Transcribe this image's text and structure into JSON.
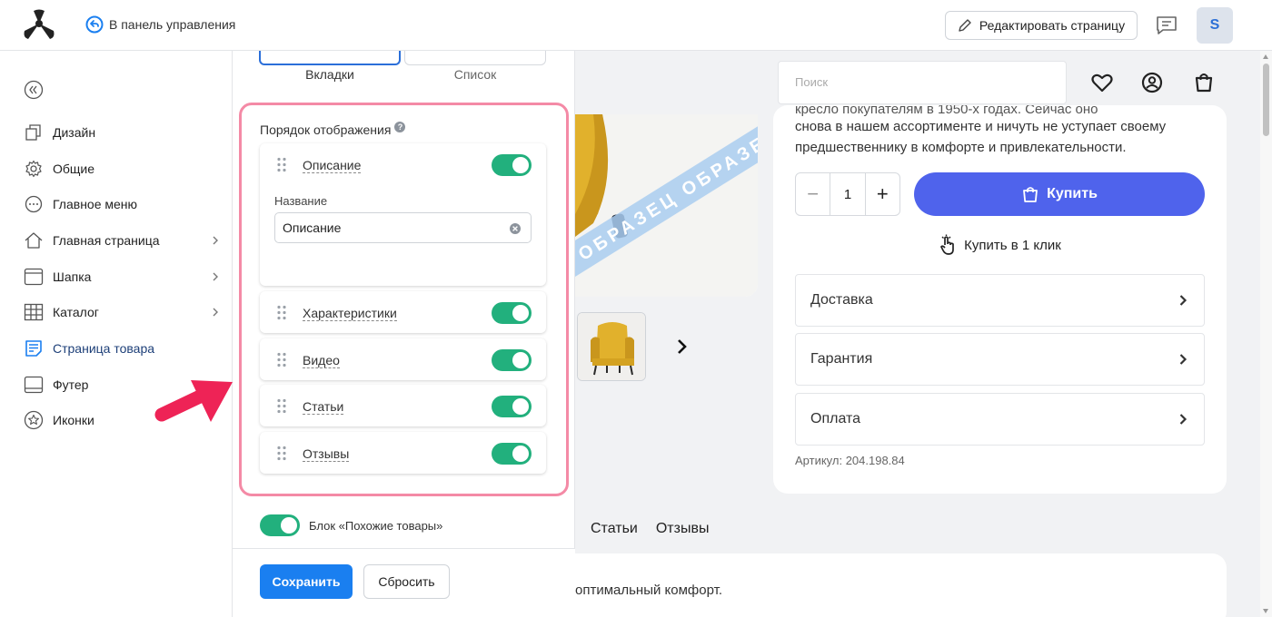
{
  "header": {
    "back_label": "В панель управления",
    "edit_page_label": "Редактировать страницу",
    "avatar_letter": "S"
  },
  "sidebar": {
    "items": [
      {
        "label": "Дизайн",
        "icon": "copy-icon"
      },
      {
        "label": "Общие",
        "icon": "gear-icon"
      },
      {
        "label": "Главное меню",
        "icon": "more-circle-icon"
      },
      {
        "label": "Главная страница",
        "icon": "home-icon",
        "has_submenu": true
      },
      {
        "label": "Шапка",
        "icon": "header-layout-icon",
        "has_submenu": true
      },
      {
        "label": "Каталог",
        "icon": "grid-icon",
        "has_submenu": true
      },
      {
        "label": "Страница товара",
        "icon": "document-icon",
        "active": true
      },
      {
        "label": "Футер",
        "icon": "footer-layout-icon"
      },
      {
        "label": "Иконки",
        "icon": "star-circle-icon"
      }
    ]
  },
  "panel": {
    "view_options": [
      "Вкладки",
      "Список"
    ],
    "selected_view": "Вкладки",
    "order_title": "Порядок отображения",
    "sections": [
      {
        "label": "Описание",
        "enabled": true,
        "expanded": true,
        "name_field_label": "Название",
        "name_field_value": "Описание"
      },
      {
        "label": "Характеристики",
        "enabled": true
      },
      {
        "label": "Видео",
        "enabled": true
      },
      {
        "label": "Статьи",
        "enabled": true
      },
      {
        "label": "Отзывы",
        "enabled": true
      }
    ],
    "similar_products_label": "Блок «Похожие товары»",
    "similar_products_enabled": true,
    "save_label": "Сохранить",
    "reset_label": "Сбросить"
  },
  "preview": {
    "search_placeholder": "Поиск",
    "watermark": "ОБРАЗЕЦ ОБРАЗЕЦ",
    "description_lines": [
      "кресло покупателям в 1950-х годах. Сейчас оно",
      "снова в нашем ассортименте и ничуть не уступает своему",
      "предшественнику в комфорте и привлекательности."
    ],
    "quantity": "1",
    "buy_label": "Купить",
    "one_click_label": "Купить в 1 клик",
    "accordion": [
      "Доставка",
      "Гарантия",
      "Оплата"
    ],
    "sku": "Артикул: 204.198.84",
    "tabs": [
      "Статьи",
      "Отзывы"
    ],
    "bottom_text": "оптимальный комфорт."
  },
  "colors": {
    "accent_blue": "#1a7ff0",
    "toggle_green": "#22b07d",
    "highlight_pink": "#f48aa6",
    "buy_button": "#4f63ec",
    "arrow_red": "#ee2356",
    "chair_yellow": "#e1b12c"
  }
}
